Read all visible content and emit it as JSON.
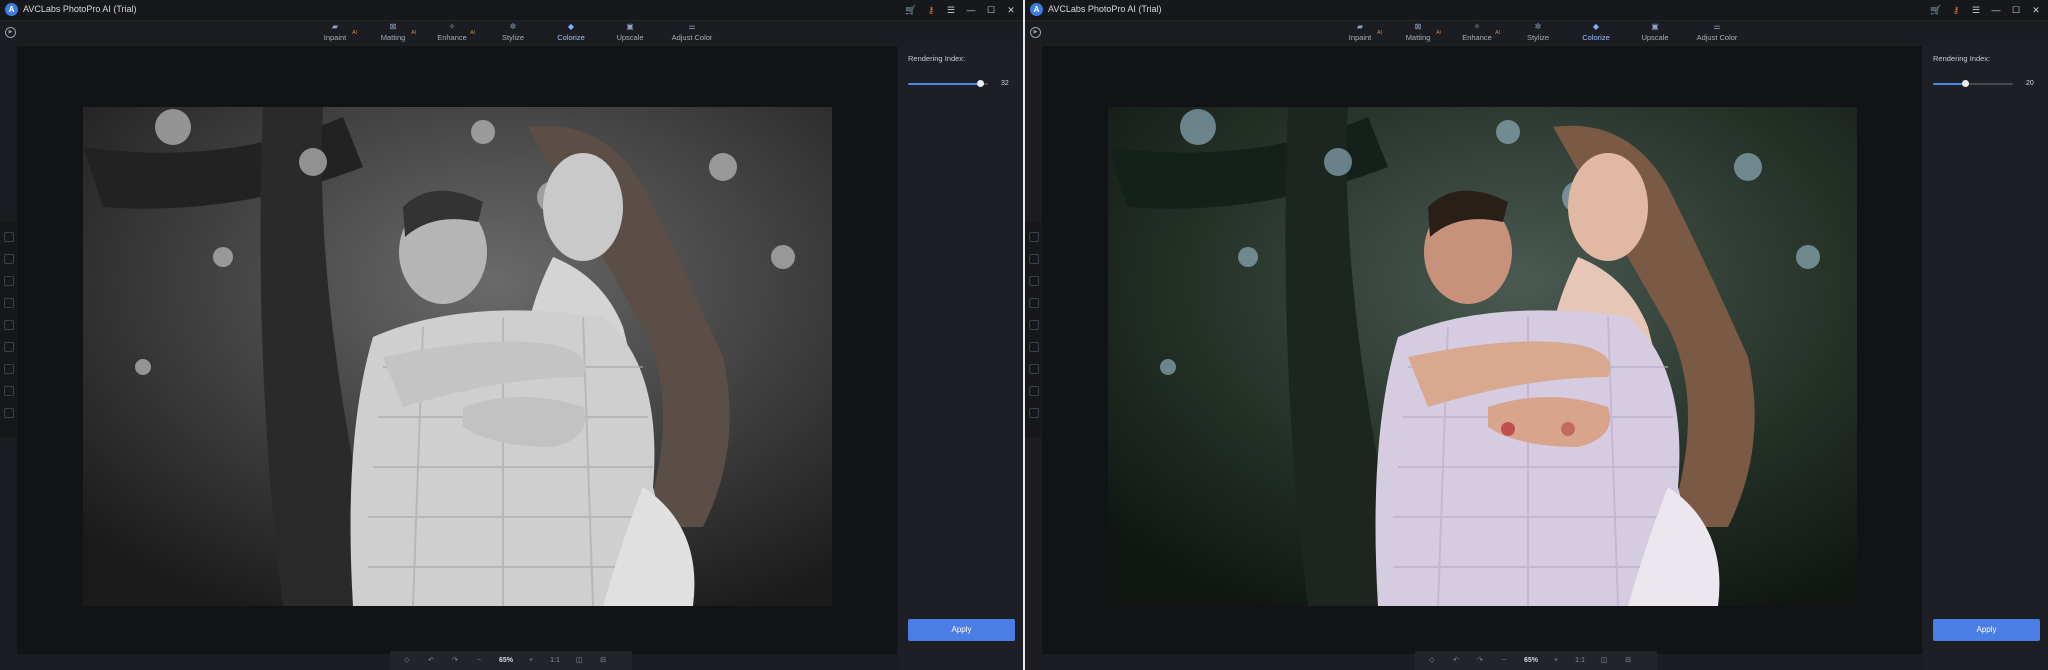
{
  "app": {
    "title": "AVCLabs PhotoPro AI (Trial)"
  },
  "tabs": [
    {
      "label": "Inpaint",
      "ai": "AI",
      "icon": "inpaint-icon"
    },
    {
      "label": "Matting",
      "ai": "AI",
      "icon": "matting-icon"
    },
    {
      "label": "Enhance",
      "ai": "AI",
      "icon": "enhance-icon"
    },
    {
      "label": "Stylize",
      "ai": "",
      "icon": "stylize-icon"
    },
    {
      "label": "Colorize",
      "ai": "",
      "icon": "colorize-icon"
    },
    {
      "label": "Upscale",
      "ai": "",
      "icon": "upscale-icon"
    },
    {
      "label": "Adjust Color",
      "ai": "",
      "icon": "adjust-color-icon"
    }
  ],
  "active_tab": "Colorize",
  "zoom_controls": {
    "minus": "−",
    "zoom": "65%",
    "plus": "+",
    "ratio": "1:1"
  },
  "panels": {
    "left": {
      "rendering_label": "Rendering Index:",
      "rendering_value": "32",
      "rendering_fraction": 0.9,
      "apply_label": "Apply",
      "photo_mode": "grayscale"
    },
    "right": {
      "rendering_label": "Rendering Index:",
      "rendering_value": "20",
      "rendering_fraction": 0.4,
      "apply_label": "Apply",
      "photo_mode": "color"
    }
  },
  "colors": {
    "accent": "#4b7ee4",
    "active_tab": "#7fb0ff",
    "window_bg": "#1b1d23"
  }
}
